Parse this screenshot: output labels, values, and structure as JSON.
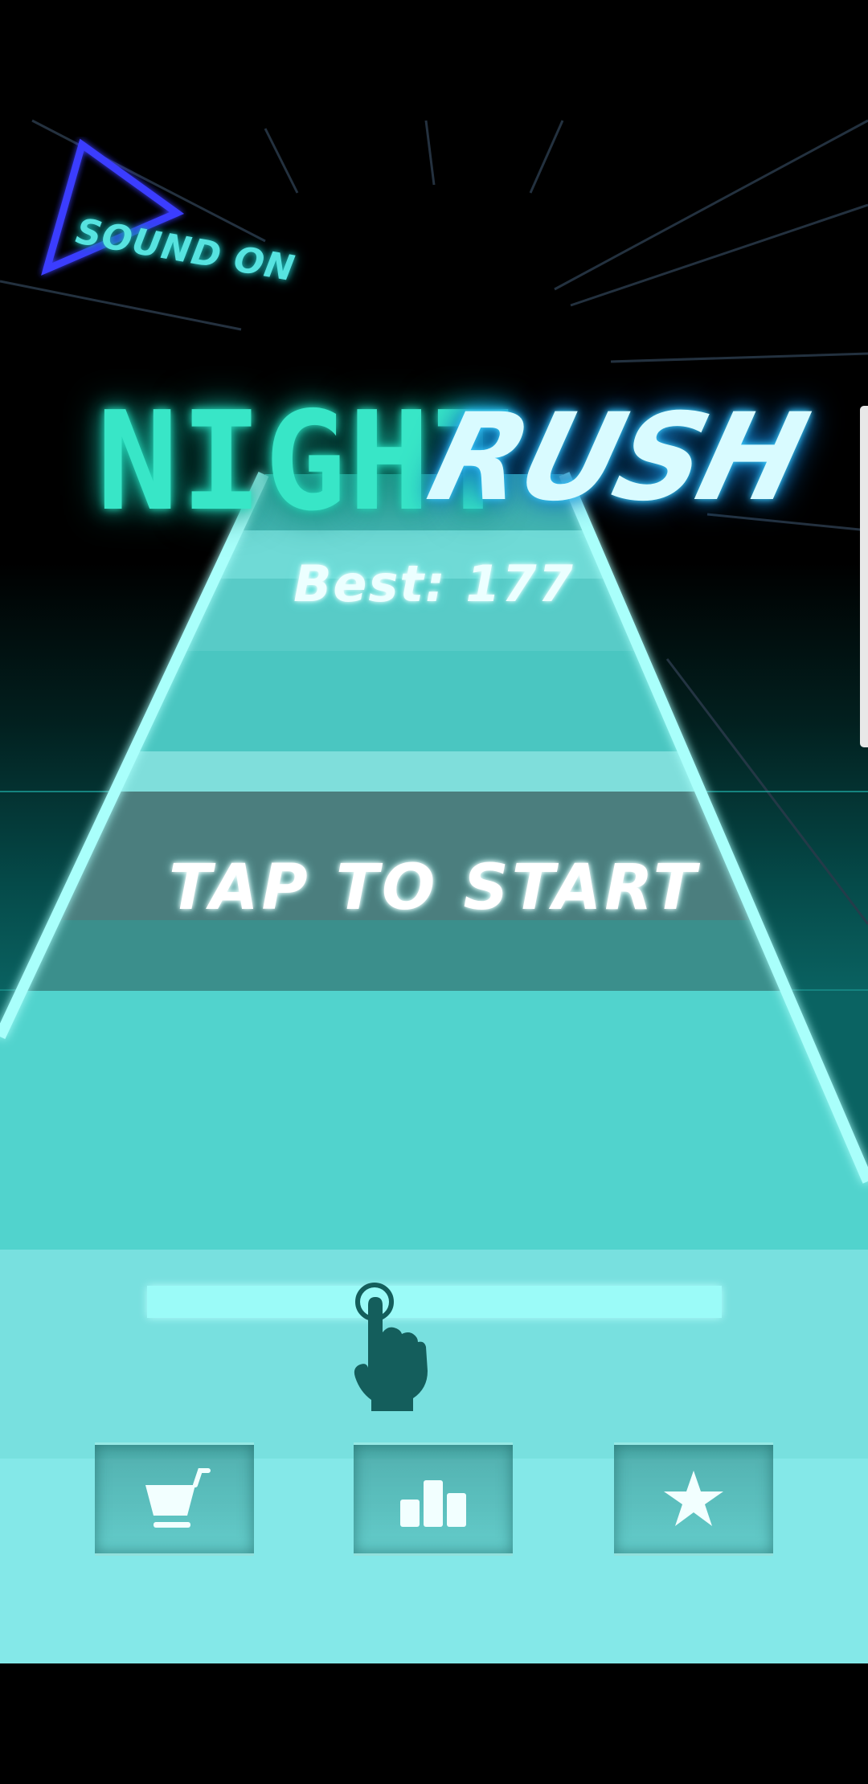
{
  "sound": {
    "label": "SOUND ON",
    "icon": "play-triangle-icon"
  },
  "title": {
    "part1": "NIGHT",
    "part2": "RUSH"
  },
  "best": {
    "text": "Best: 177"
  },
  "prompt": {
    "text": "TAP TO START"
  },
  "tutorial": {
    "icon": "tap-hand-icon"
  },
  "menu": [
    {
      "name": "shop",
      "icon": "shopping-cart-icon"
    },
    {
      "name": "leaderboard",
      "icon": "bar-chart-icon"
    },
    {
      "name": "rate",
      "icon": "star-icon"
    }
  ],
  "colors": {
    "background": "#000000",
    "road": "#4fd6d0",
    "road_light": "#7fe6e4",
    "neon_edge": "#a9fffb",
    "title_night": "#38e6c7",
    "title_rush": "#d9fbff",
    "sound_triangle": "#3a3cff"
  }
}
